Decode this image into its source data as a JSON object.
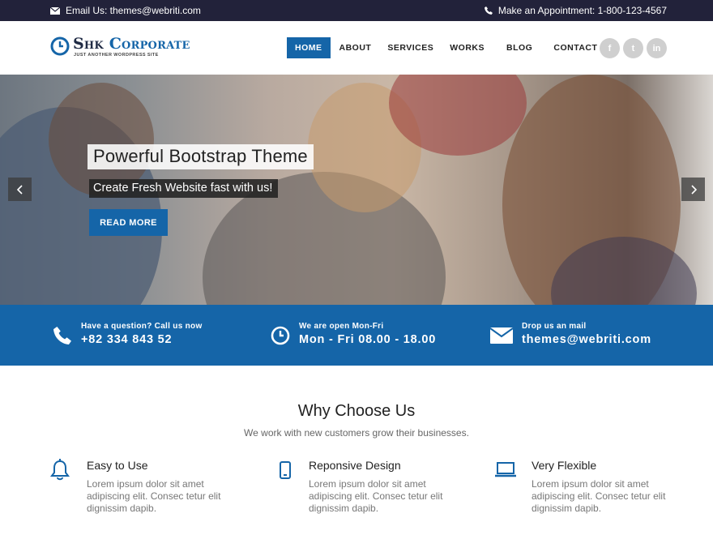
{
  "topbar": {
    "email": "Email Us: themes@webriti.com",
    "phone": "Make an Appointment: 1-800-123-4567"
  },
  "logo": {
    "first": "Shk",
    "second": "Corporate",
    "tagline": "JUST ANOTHER WORDPRESS SITE"
  },
  "nav": {
    "items": [
      "HOME",
      "ABOUT",
      "SERVICES",
      "WORKS",
      "BLOG",
      "CONTACT"
    ],
    "active": "HOME"
  },
  "social": {
    "icons": [
      "facebook-icon",
      "twitter-icon",
      "linkedin-icon"
    ],
    "glyphs": [
      "f",
      "t",
      "in"
    ]
  },
  "hero": {
    "title": "Powerful Bootstrap Theme",
    "subtitle": "Create Fresh Website fast with us!",
    "button": "READ MORE"
  },
  "info": [
    {
      "icon": "phone-icon",
      "label": "Have a question? Call us now",
      "value": "+82 334 843 52"
    },
    {
      "icon": "clock-icon",
      "label": "We are open Mon-Fri",
      "value": "Mon - Fri 08.00 - 18.00"
    },
    {
      "icon": "envelope-icon",
      "label": "Drop us an mail",
      "value": "themes@webriti.com"
    }
  ],
  "why": {
    "title": "Why Choose Us",
    "subtitle": "We work with new customers grow their businesses."
  },
  "features": [
    {
      "icon": "bell-icon",
      "title": "Easy to Use",
      "text": "Lorem ipsum dolor sit amet adipiscing elit. Consec tetur elit dignissim dapib."
    },
    {
      "icon": "mobile-icon",
      "title": "Reponsive Design",
      "text": "Lorem ipsum dolor sit amet adipiscing elit. Consec tetur elit dignissim dapib."
    },
    {
      "icon": "laptop-icon",
      "title": "Very Flexible",
      "text": "Lorem ipsum dolor sit amet adipiscing elit. Consec tetur elit dignissim dapib."
    }
  ],
  "colors": {
    "accent": "#1565a8",
    "topbar": "#22223a"
  }
}
